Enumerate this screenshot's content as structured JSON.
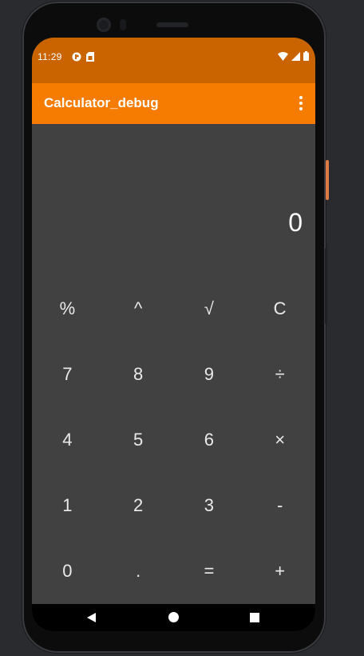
{
  "status_bar": {
    "time": "11:29",
    "left_icons": [
      "app-notification-icon",
      "sim-card-icon"
    ],
    "right_icons": [
      "wifi-icon",
      "cellular-signal-icon",
      "battery-icon"
    ]
  },
  "app_bar": {
    "title": "Calculator_debug",
    "menu_icon": "more-vert-icon"
  },
  "display": {
    "value": "0"
  },
  "keypad": {
    "rows": [
      [
        "%",
        "^",
        "√",
        "C"
      ],
      [
        "7",
        "8",
        "9",
        "÷"
      ],
      [
        "4",
        "5",
        "6",
        "×"
      ],
      [
        "1",
        "2",
        "3",
        "-"
      ],
      [
        "0",
        ".",
        "=",
        "+"
      ]
    ]
  },
  "nav_bar": {
    "buttons": [
      "back-icon",
      "home-icon",
      "recents-icon"
    ]
  },
  "colors": {
    "status_bar": "#c96400",
    "app_bar": "#f57c00",
    "screen_bg": "#414141",
    "text": "#ffffff"
  }
}
